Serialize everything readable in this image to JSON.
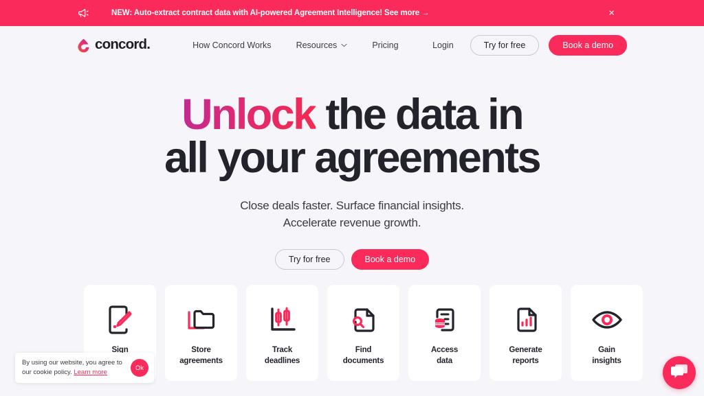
{
  "announcement": {
    "icon": "megaphone-icon",
    "text": "NEW: Auto-extract contract data with AI-powered Agreement Intelligence! See more →",
    "close_label": "×",
    "bg_color": "#FA2B5A"
  },
  "header": {
    "brand": {
      "name": "concord.",
      "mark_icon": "concord-droplet-logo"
    },
    "nav": [
      {
        "label": "How Concord Works",
        "has_chevron": false
      },
      {
        "label": "Resources",
        "has_chevron": true
      },
      {
        "label": "Pricing",
        "has_chevron": false
      }
    ],
    "login_label": "Login",
    "try_free_label": "Try for free",
    "book_demo_label": "Book a demo"
  },
  "hero": {
    "title_highlight": "Unlock",
    "title_rest": " the data in",
    "title_line2": "all your agreements",
    "subtitle_line1": "Close deals faster. Surface financial insights.",
    "subtitle_line2": "Accelerate revenue growth.",
    "try_free_label": "Try for free",
    "book_demo_label": "Book a demo",
    "highlight_gradient_from": "#C22A93",
    "highlight_gradient_to": "#F42B51"
  },
  "features": [
    {
      "label": "Sign",
      "icon": "document-pen-sign-icon"
    },
    {
      "label": "Store\nagreements",
      "icon": "folder-icon"
    },
    {
      "label": "Track\ndeadlines",
      "icon": "candlestick-chart-icon"
    },
    {
      "label": "Find\ndocuments",
      "icon": "document-search-icon"
    },
    {
      "label": "Access\ndata",
      "icon": "document-database-icon"
    },
    {
      "label": "Generate\nreports",
      "icon": "document-bar-chart-icon"
    },
    {
      "label": "Gain\ninsights",
      "icon": "eye-icon"
    }
  ],
  "cookie_banner": {
    "text_part1": "By using our website, you agree to our cookie policy. ",
    "link_label": "Learn more",
    "ok_label": "Ok"
  },
  "chat": {
    "icon": "chat-bubbles-icon",
    "bg_color": "#FA2B5A"
  },
  "theme": {
    "page_bg": "#F6F6FA",
    "accent": "#FA2B5A",
    "text": "#23232B"
  }
}
